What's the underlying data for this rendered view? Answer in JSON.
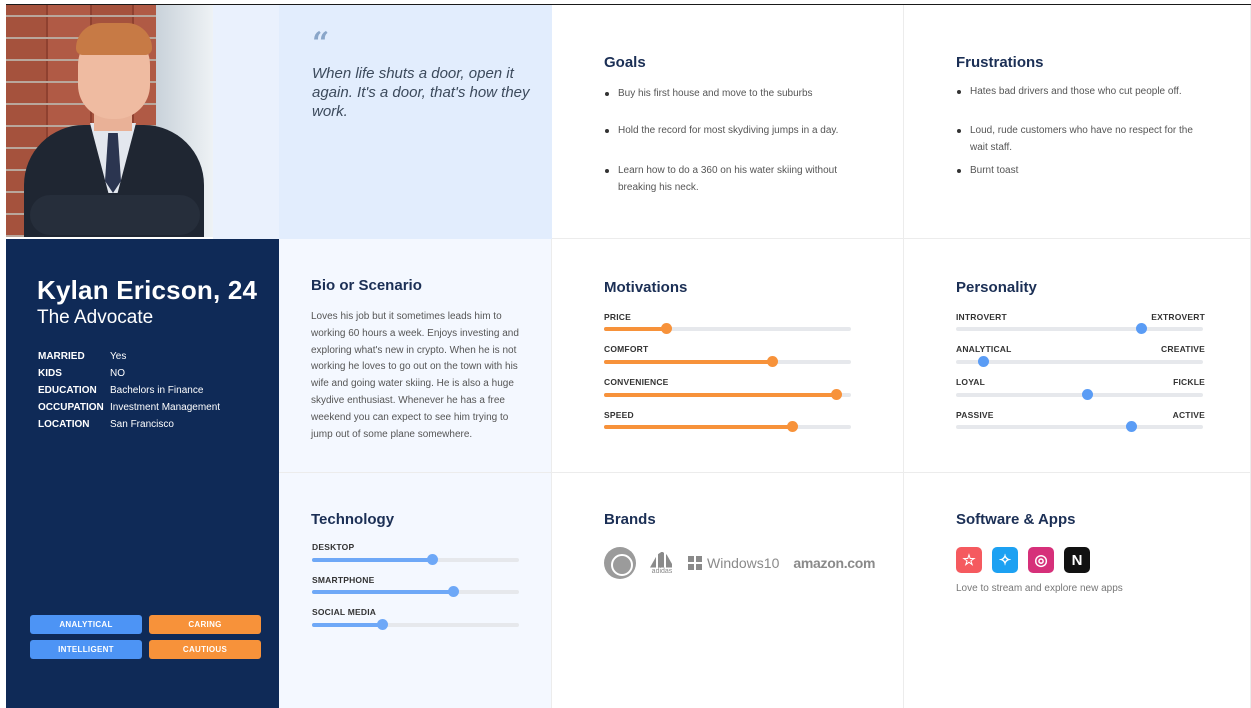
{
  "quote": {
    "mark": "“",
    "text": "When life shuts a door, open it again. It's a door, that's how they work."
  },
  "goals": {
    "title": "Goals",
    "items": [
      "Buy his first house and move to the suburbs",
      "Hold the record for most skydiving jumps in a day.",
      "Learn how to do a 360 on his water skiing without breaking his neck."
    ]
  },
  "frustrations": {
    "title": "Frustrations",
    "items": [
      "Hates bad drivers and those who cut people off.",
      "Loud, rude customers who have no respect for the wait staff.",
      "Burnt toast"
    ]
  },
  "profile": {
    "name": "Kylan Ericson, 24",
    "role": "The Advocate",
    "facts": [
      {
        "key": "MARRIED",
        "value": "Yes"
      },
      {
        "key": "KIDS",
        "value": "NO"
      },
      {
        "key": "EDUCATION",
        "value": "Bachelors in Finance"
      },
      {
        "key": "OCCUPATION",
        "value": "Investment Management"
      },
      {
        "key": "LOCATION",
        "value": "San Francisco"
      }
    ],
    "tags": [
      {
        "label": "ANALYTICAL",
        "color": "#4d94f5"
      },
      {
        "label": "CARING",
        "color": "#f7923a"
      },
      {
        "label": "INTELLIGENT",
        "color": "#4d94f5"
      },
      {
        "label": "CAUTIOUS",
        "color": "#f7923a"
      }
    ]
  },
  "bio": {
    "title": "Bio or Scenario",
    "text": "Loves his job but it sometimes leads him to working 60 hours a week. Enjoys investing and exploring what's new in crypto. When he is not working he loves to go out on the town with his wife and going water skiing. He is also a huge skydive enthusiast. Whenever he has a free weekend you can expect to see him trying to jump out of some plane somewhere."
  },
  "motivations": {
    "title": "Motivations",
    "color": "#f7923a",
    "items": [
      {
        "label": "PRICE",
        "value": 0.25
      },
      {
        "label": "COMFORT",
        "value": 0.68
      },
      {
        "label": "CONVENIENCE",
        "value": 0.94
      },
      {
        "label": "SPEED",
        "value": 0.76
      }
    ]
  },
  "personality": {
    "title": "Personality",
    "color": "#5a9cf5",
    "items": [
      {
        "left": "INTROVERT",
        "right": "EXTROVERT",
        "value": 0.75
      },
      {
        "left": "ANALYTICAL",
        "right": "CREATIVE",
        "value": 0.11
      },
      {
        "left": "LOYAL",
        "right": "FICKLE",
        "value": 0.53
      },
      {
        "left": "PASSIVE",
        "right": "ACTIVE",
        "value": 0.71
      }
    ]
  },
  "technology": {
    "title": "Technology",
    "color": "#6ea8f7",
    "items": [
      {
        "label": "DESKTOP",
        "value": 0.58
      },
      {
        "label": "SMARTPHONE",
        "value": 0.68
      },
      {
        "label": "SOCIAL MEDIA",
        "value": 0.34
      }
    ]
  },
  "brands": {
    "title": "Brands",
    "items": [
      {
        "icon": "starbucks-logo",
        "label": ""
      },
      {
        "icon": "adidas-logo",
        "label": "adidas"
      },
      {
        "icon": "windows-logo",
        "label": "Windows10"
      },
      {
        "icon": "amazon-logo",
        "label": "amazon.com"
      }
    ]
  },
  "apps": {
    "title": "Software & Apps",
    "items": [
      {
        "icon": "airbnb-icon",
        "glyph": "☆",
        "color": "#f55a5f"
      },
      {
        "icon": "twitter-icon",
        "glyph": "✧",
        "color": "#1da1f2"
      },
      {
        "icon": "instagram-icon",
        "glyph": "◎",
        "color": "#d6307a"
      },
      {
        "icon": "netflix-icon",
        "glyph": "N",
        "color": "#111111"
      }
    ],
    "note": "Love to stream and explore new apps"
  }
}
